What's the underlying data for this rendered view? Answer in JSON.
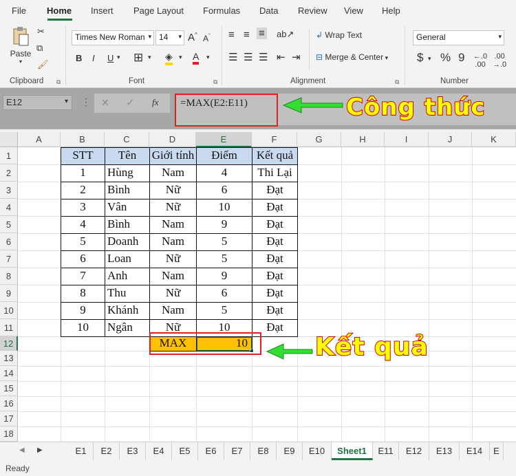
{
  "menu": [
    "File",
    "Home",
    "Insert",
    "Page Layout",
    "Formulas",
    "Data",
    "Review",
    "View",
    "Help"
  ],
  "ribbon": {
    "clipboard": {
      "paste": "Paste",
      "label": "Clipboard"
    },
    "font": {
      "family": "Times New Roman",
      "size": "14",
      "bold": "B",
      "italic": "I",
      "underline": "U",
      "grow": "A",
      "shrink": "A",
      "label": "Font"
    },
    "alignment": {
      "wrap": "Wrap Text",
      "merge": "Merge & Center",
      "label": "Alignment"
    },
    "number": {
      "format": "General",
      "currency": "$",
      "percent": "%",
      "comma": "9",
      "label": "Number"
    }
  },
  "formula_bar": {
    "name_box": "E12",
    "fx": "fx",
    "formula": "=MAX(E2:E11)"
  },
  "callouts": {
    "formula": "Công thức",
    "result": "Kết quả"
  },
  "columns": [
    "A",
    "B",
    "C",
    "D",
    "E",
    "F",
    "G",
    "H",
    "I",
    "J",
    "K"
  ],
  "rows": [
    "1",
    "2",
    "3",
    "4",
    "5",
    "6",
    "7",
    "8",
    "9",
    "10",
    "11",
    "12",
    "13",
    "14",
    "15",
    "16",
    "17",
    "18"
  ],
  "table": {
    "headers": [
      "STT",
      "Tên",
      "Giới tính",
      "Điểm",
      "Kết quả"
    ],
    "rows": [
      [
        "1",
        "Hùng",
        "Nam",
        "4",
        "Thi Lại"
      ],
      [
        "2",
        "Bình",
        "Nữ",
        "6",
        "Đạt"
      ],
      [
        "3",
        "Vân",
        "Nữ",
        "10",
        "Đạt"
      ],
      [
        "4",
        "Bình",
        "Nam",
        "9",
        "Đạt"
      ],
      [
        "5",
        "Doanh",
        "Nam",
        "5",
        "Đạt"
      ],
      [
        "6",
        "Loan",
        "Nữ",
        "5",
        "Đạt"
      ],
      [
        "7",
        "Anh",
        "Nam",
        "9",
        "Đạt"
      ],
      [
        "8",
        "Thu",
        "Nữ",
        "6",
        "Đạt"
      ],
      [
        "9",
        "Khánh",
        "Nam",
        "5",
        "Đạt"
      ],
      [
        "10",
        "Ngân",
        "Nữ",
        "10",
        "Đạt"
      ]
    ],
    "max_label": "MAX",
    "max_value": "10"
  },
  "sheet_tabs": [
    "E1",
    "E2",
    "E3",
    "E4",
    "E5",
    "E6",
    "E7",
    "E8",
    "E9",
    "E10",
    "Sheet1",
    "E11",
    "E12",
    "E13",
    "E14",
    "E"
  ],
  "active_sheet": "Sheet1",
  "status": "Ready",
  "colors": {
    "accent": "#217346",
    "header_fill": "#c9daf0",
    "max_fill": "#ffc000",
    "callout_red": "#e0201f",
    "callout_yellow": "#ffff00",
    "arrow_green": "#33dd33"
  }
}
